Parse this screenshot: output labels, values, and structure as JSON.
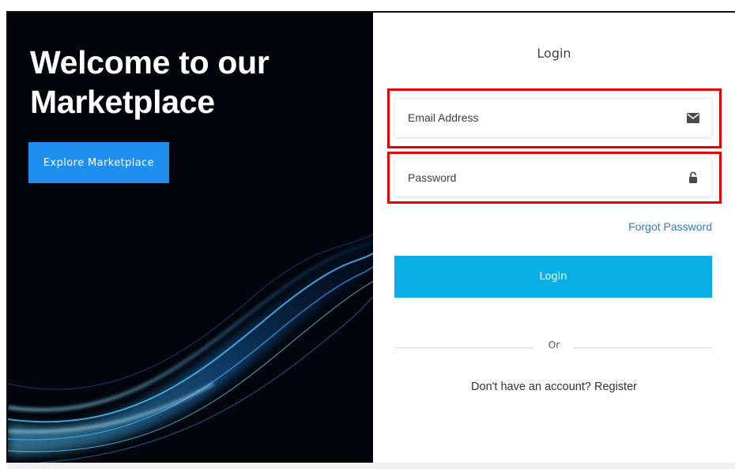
{
  "hero": {
    "title_line1": "Welcome to our",
    "title_line2": "Marketplace",
    "explore_button": "Explore Marketplace"
  },
  "login_form": {
    "title": "Login",
    "email": {
      "placeholder": "Email Address",
      "value": "",
      "icon": "envelope-icon"
    },
    "password": {
      "placeholder": "Password",
      "value": "",
      "icon": "unlocked-padlock-icon"
    },
    "forgot_password": "Forgot Password",
    "submit_label": "Login",
    "divider_text": "Or",
    "register_prompt": "Don't have an account?",
    "register_link": "Register"
  },
  "colors": {
    "hero_bg": "#02050c",
    "explore_button": "#1e8fef",
    "login_button": "#09aee6",
    "link": "#2b7fc7",
    "highlight": "#e60000"
  }
}
